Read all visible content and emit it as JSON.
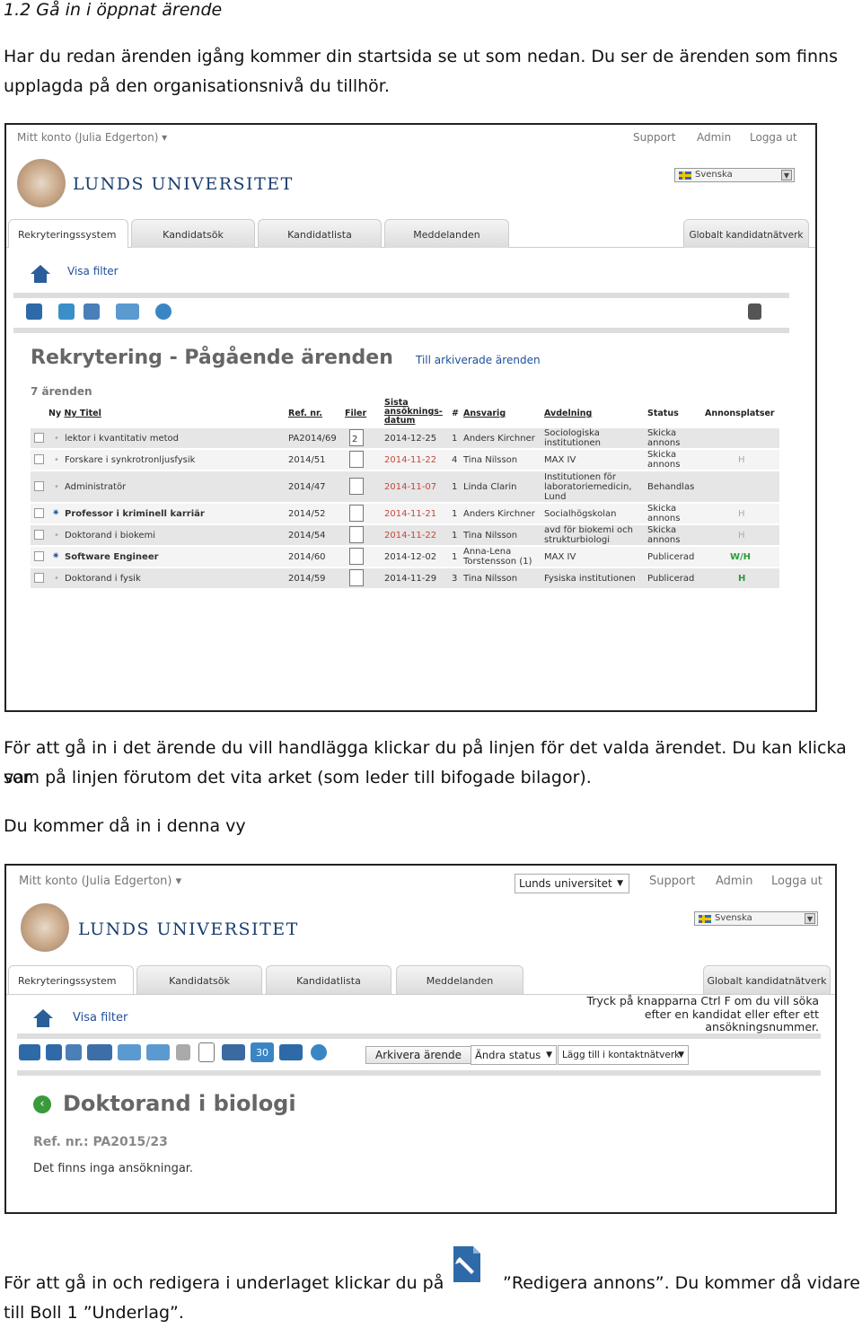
{
  "doc": {
    "heading": "1.2 Gå in i öppnat ärende",
    "para1_line1": "Har du redan ärenden igång kommer din startsida se ut som nedan. Du ser de ärenden som finns",
    "para1_line2": "upplagda på den organisationsnivå du tillhör.",
    "para2_line1": "För att gå in i det ärende du vill handlägga klickar du på linjen för det valda ärendet. Du kan klicka var",
    "para2_line2": "som på linjen förutom det vita arket (som leder till bifogade bilagor).",
    "para3": "Du kommer då in i denna vy",
    "para4_line1_a": "För att gå in och redigera i underlaget klickar du på",
    "para4_line1_b": "”Redigera annons”. Du kommer då vidare",
    "para4_line2": "till Boll 1 ”Underlag”."
  },
  "shot1": {
    "account": "Mitt konto (Julia Edgerton) ▾",
    "support": "Support",
    "admin": "Admin",
    "logout": "Logga ut",
    "language": "Svenska",
    "logo_text": "LUNDS UNIVERSITET",
    "tabs": [
      "Rekryteringssystem",
      "Kandidatsök",
      "Kandidatlista",
      "Meddelanden",
      "Globalt kandidatnätverk"
    ],
    "show_filter": "Visa filter",
    "page_title": "Rekrytering - Pågående ärenden",
    "archived_link": "Till arkiverade ärenden",
    "count": "7 ärenden",
    "columns": {
      "new_title": "Ny Titel",
      "ref": "Ref. nr.",
      "files": "Filer",
      "deadline_1": "Sista",
      "deadline_2": "ansöknings-",
      "deadline_3": "datum",
      "num": "#",
      "responsible": "Ansvarig",
      "department": "Avdelning",
      "status": "Status",
      "ads": "Annonsplatser"
    },
    "rows": [
      {
        "title": "lektor i kvantitativ metod",
        "ref": "PA2014/69",
        "files": "2",
        "date": "2014-12-25",
        "num": "1",
        "resp": "Anders Kirchner",
        "dept1": "Sociologiska",
        "dept2": "institutionen",
        "status1": "Skicka",
        "status2": "annons",
        "ads": ""
      },
      {
        "title": "Forskare i synkrotronljusfysik",
        "ref": "2014/51",
        "files": "",
        "date": "2014-11-22",
        "num": "4",
        "resp": "Tina Nilsson",
        "dept1": "MAX IV",
        "dept2": "",
        "status1": "Skicka",
        "status2": "annons",
        "ads": "H"
      },
      {
        "title": "Administratör",
        "ref": "2014/47",
        "files": "",
        "date": "2014-11-07",
        "num": "1",
        "resp": "Linda Clarin",
        "dept1": "Institutionen för",
        "dept2": "laboratoriemedicin,",
        "dept3": "Lund",
        "status1": "Behandlas",
        "status2": "",
        "ads": ""
      },
      {
        "title": "Professor i kriminell karriär",
        "ref": "2014/52",
        "files": "",
        "date": "2014-11-21",
        "num": "1",
        "resp": "Anders Kirchner",
        "dept1": "Socialhögskolan",
        "dept2": "",
        "status1": "Skicka",
        "status2": "annons",
        "ads": "H"
      },
      {
        "title": "Doktorand i biokemi",
        "ref": "2014/54",
        "files": "",
        "date": "2014-11-22",
        "num": "1",
        "resp": "Tina Nilsson",
        "dept1": "avd för biokemi och",
        "dept2": "strukturbiologi",
        "status1": "Skicka",
        "status2": "annons",
        "ads": "H"
      },
      {
        "title": "Software Engineer",
        "ref": "2014/60",
        "files": "",
        "date": "2014-12-02",
        "num": "1",
        "resp": "Anna-Lena",
        "resp2": "Torstensson (1)",
        "dept1": "MAX IV",
        "dept2": "",
        "status1": "Publicerad",
        "status2": "",
        "ads": "W/H"
      },
      {
        "title": "Doktorand i fysik",
        "ref": "2014/59",
        "files": "",
        "date": "2014-11-29",
        "num": "3",
        "resp": "Tina Nilsson",
        "dept1": "Fysiska institutionen",
        "dept2": "",
        "status1": "Publicerad",
        "status2": "",
        "ads": "H"
      }
    ]
  },
  "shot2": {
    "account": "Mitt konto (Julia Edgerton) ▾",
    "org_select": "Lunds universitet",
    "support": "Support",
    "admin": "Admin",
    "logout": "Logga ut",
    "language": "Svenska",
    "logo_text": "LUNDS UNIVERSITET",
    "tabs": [
      "Rekryteringssystem",
      "Kandidatsök",
      "Kandidatlista",
      "Meddelanden",
      "Globalt kandidatnätverk"
    ],
    "show_filter": "Visa filter",
    "hint_1": "Tryck på knapparna Ctrl F om du vill söka",
    "hint_2": "efter en kandidat eller efter ett",
    "hint_3": "ansökningsnummer.",
    "archive_button": "Arkivera ärende",
    "change_status": "Ändra status",
    "add_network": "Lägg till i kontaktnätverk",
    "calendar_day": "30",
    "page_title": "Doktorand i biologi",
    "ref_label": "Ref. nr.: PA2015/23",
    "no_applications": "Det finns inga ansökningar."
  }
}
